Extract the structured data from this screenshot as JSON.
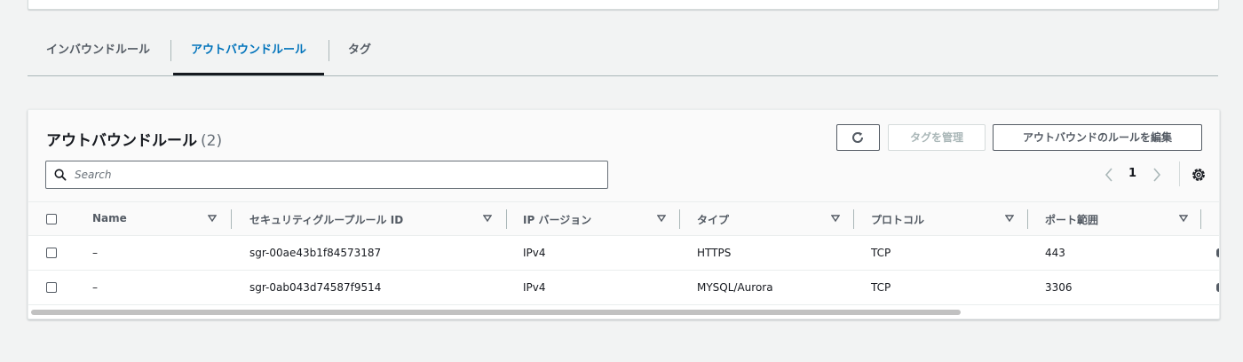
{
  "tabs": [
    {
      "label": "インバウンドルール",
      "active": false
    },
    {
      "label": "アウトバウンドルール",
      "active": true
    },
    {
      "label": "タグ",
      "active": false
    }
  ],
  "panel": {
    "title": "アウトバウンドルール",
    "count": "(2)",
    "buttons": {
      "refresh_icon": "refresh-icon",
      "manage_tags": "タグを管理",
      "edit_rules": "アウトバウンドのルールを編集"
    },
    "search": {
      "placeholder": "Search",
      "value": ""
    },
    "pagination": {
      "current_page": "1"
    }
  },
  "table": {
    "columns": [
      "Name",
      "セキュリティグループルール ID",
      "IP バージョン",
      "タイプ",
      "プロトコル",
      "ポート範囲"
    ],
    "rows": [
      {
        "name": "–",
        "rule_id": "sgr-00ae43b1f84573187",
        "ip_version": "IPv4",
        "type": "HTTPS",
        "protocol": "TCP",
        "port_range": "443"
      },
      {
        "name": "–",
        "rule_id": "sgr-0ab043d74587f9514",
        "ip_version": "IPv4",
        "type": "MYSQL/Aurora",
        "protocol": "TCP",
        "port_range": "3306"
      }
    ]
  },
  "colors": {
    "accent": "#0073bb",
    "text": "#16191f",
    "muted": "#545b64",
    "background": "#f2f3f3"
  }
}
